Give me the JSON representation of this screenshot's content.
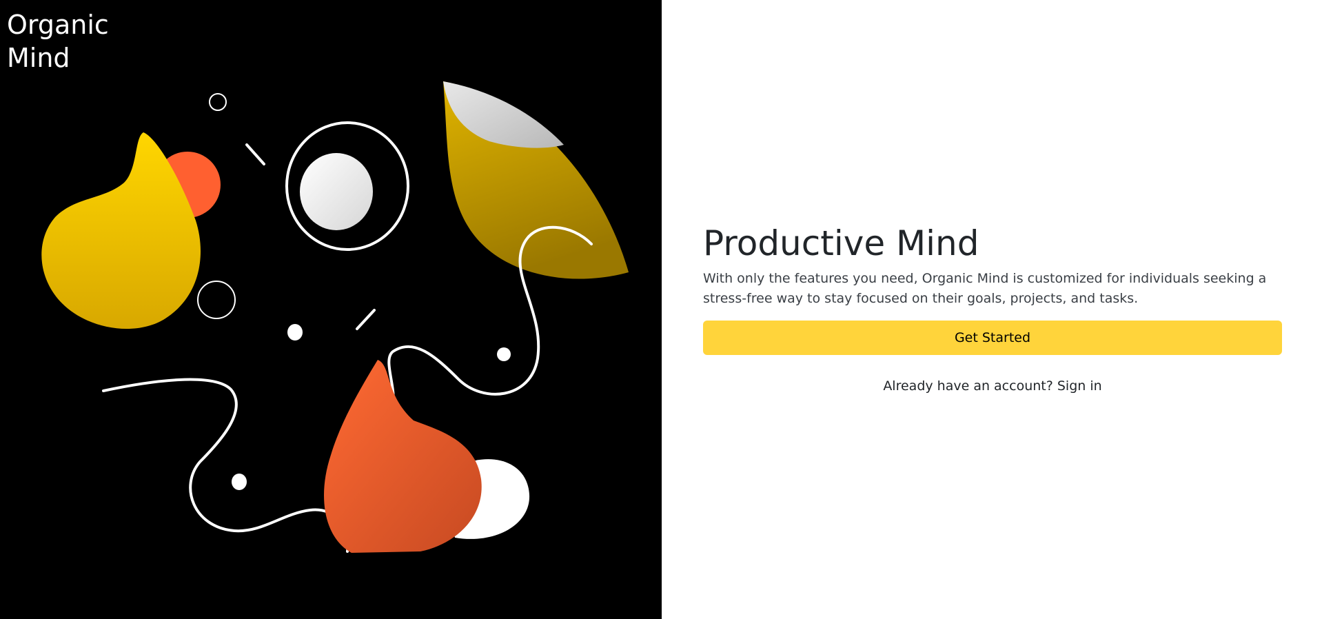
{
  "brand": {
    "line1": "Organic",
    "line2": "Mind"
  },
  "hero": {
    "title": "Productive Mind",
    "description": "With only the features you need, Organic Mind is customized for individuals seeking a stress-free way to stay focused on their goals, projects, and tasks.",
    "cta_label": "Get Started",
    "signin_prompt": "Already have an account?",
    "signin_link": "Sign in"
  },
  "illustration": {
    "name": "abstract-organic-shapes",
    "colors": {
      "background": "#000000",
      "yellow": "#ffd000",
      "orange": "#ff6030",
      "white": "#ffffff"
    }
  },
  "colors": {
    "accent": "#ffd43b",
    "text": "#212529",
    "panel_dark": "#000000"
  }
}
